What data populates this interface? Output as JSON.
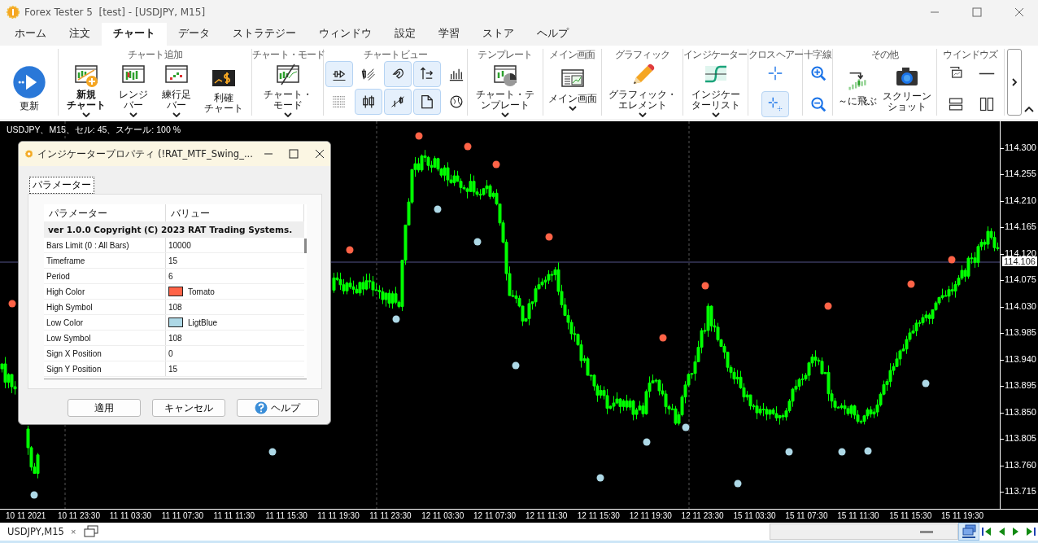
{
  "window": {
    "title": "Forex Tester 5  [test] - [USDJPY, M15]"
  },
  "menu_tabs": [
    {
      "label": "ホーム",
      "selected": false
    },
    {
      "label": "注文",
      "selected": false
    },
    {
      "label": "チャート",
      "selected": true
    },
    {
      "label": "データ",
      "selected": false
    },
    {
      "label": "ストラテジー",
      "selected": false
    },
    {
      "label": "ウィンドウ",
      "selected": false
    },
    {
      "label": "設定",
      "selected": false
    },
    {
      "label": "学習",
      "selected": false
    },
    {
      "label": "ストア",
      "selected": false
    },
    {
      "label": "ヘルプ",
      "selected": false
    }
  ],
  "ribbon": {
    "groups": [
      {
        "items": [
          {
            "kind": "large",
            "lines": [
              "更新"
            ],
            "caret": false
          }
        ]
      },
      {
        "label": "チャート追加",
        "items": [
          {
            "kind": "large",
            "lines": [
              "新規",
              "チャート"
            ],
            "caret": true,
            "default": true
          },
          {
            "kind": "large",
            "lines": [
              "レンジ",
              "バー"
            ],
            "caret": true
          },
          {
            "kind": "large",
            "lines": [
              "練行足",
              "バー"
            ],
            "caret": true
          },
          {
            "kind": "large",
            "lines": [
              "利確",
              "チャート"
            ],
            "caret": false
          }
        ]
      },
      {
        "label": "チャート・モード",
        "items": [
          {
            "kind": "large",
            "lines": [
              "チャート・",
              "モード"
            ],
            "caret": true
          }
        ]
      },
      {
        "label": "チャートビュー",
        "items": [
          {
            "kind": "small",
            "selected": true
          },
          {
            "kind": "small",
            "selected": false
          },
          {
            "kind": "small",
            "selected": true
          },
          {
            "kind": "small",
            "selected": true
          },
          {
            "kind": "small",
            "selected": false
          },
          {
            "kind": "small",
            "selected": false
          },
          {
            "kind": "small",
            "selected": true
          },
          {
            "kind": "small",
            "selected": true
          },
          {
            "kind": "small",
            "selected": true
          },
          {
            "kind": "small",
            "selected": false
          }
        ]
      },
      {
        "label": "テンプレート",
        "items": [
          {
            "kind": "large",
            "lines": [
              "チャート・テ",
              "ンプレート"
            ],
            "caret": true
          }
        ]
      },
      {
        "label": "メイン画面",
        "items": [
          {
            "kind": "large",
            "lines": [
              "メイン画面"
            ],
            "caret": true
          }
        ]
      },
      {
        "label": "グラフィック",
        "items": [
          {
            "kind": "large",
            "lines": [
              "グラフィック・",
              "エレメント"
            ],
            "caret": true
          }
        ]
      },
      {
        "label": "インジケーター",
        "items": [
          {
            "kind": "large",
            "lines": [
              "インジケー",
              "ターリスト"
            ],
            "caret": true
          }
        ]
      },
      {
        "label": "クロスヘアー",
        "items": [
          {
            "kind": "small",
            "selected": false
          },
          {
            "kind": "small",
            "selected": true
          }
        ]
      },
      {
        "label": "十字線",
        "items": [
          {
            "kind": "small",
            "selected": false
          },
          {
            "kind": "small",
            "selected": false
          }
        ]
      },
      {
        "label": "その他",
        "items": [
          {
            "kind": "large",
            "lines": [
              "～に飛ぶ"
            ],
            "caret": false
          },
          {
            "kind": "large",
            "lines": [
              "スクリーン",
              "ショット"
            ],
            "caret": false
          }
        ]
      },
      {
        "label": "ウインドウズ",
        "items": [
          {
            "kind": "small",
            "selected": false
          },
          {
            "kind": "small",
            "selected": false
          },
          {
            "kind": "small",
            "selected": false
          },
          {
            "kind": "small",
            "selected": false
          }
        ]
      }
    ]
  },
  "chart": {
    "info": "USDJPY、M15、セル: 45、スケール: 100 %",
    "price_labels": [
      "114.300",
      "114.255",
      "114.210",
      "114.165",
      "114.120",
      "114.075",
      "114.030",
      "113.985",
      "113.940",
      "113.895",
      "113.850",
      "113.805",
      "113.760",
      "113.715"
    ],
    "current_price": "114.106",
    "time_labels": [
      "10 11 2021",
      "10 11 23:30",
      "11 11 03:30",
      "11 11 07:30",
      "11 11 11:30",
      "11 11 15:30",
      "11 11 19:30",
      "11 11 23:30",
      "12 11 03:30",
      "12 11 07:30",
      "12 11 11:30",
      "12 11 15:30",
      "12 11 19:30",
      "12 11 23:30",
      "15 11 03:30",
      "15 11 07:30",
      "15 11 11:30",
      "15 11 15:30",
      "15 11 19:30"
    ]
  },
  "dialog": {
    "title": "インジケータープロパティ (!RAT_MTF_Swing_...",
    "tabs": [
      {
        "label": "パラメーター",
        "selected": true
      }
    ],
    "columns": [
      "パラメーター",
      "バリュー"
    ],
    "group_row": "ver 1.0.0 Copyright (C) 2023 RAT Trading Systems.",
    "rows": [
      {
        "kind": "text",
        "name": "Bars Limit (0 : All Bars)",
        "value": "10000"
      },
      {
        "kind": "text",
        "name": "Timeframe",
        "value": "15"
      },
      {
        "kind": "text",
        "name": "Period",
        "value": "6"
      },
      {
        "kind": "color",
        "name": "High Color",
        "value": "Tomato",
        "color": "#ff6347"
      },
      {
        "kind": "text",
        "name": "High Symbol",
        "value": "108"
      },
      {
        "kind": "color",
        "name": "Low Color",
        "value": "LigtBlue",
        "color": "#add8e6"
      },
      {
        "kind": "text",
        "name": "Low Symbol",
        "value": "108"
      },
      {
        "kind": "text",
        "name": "Sign X Position",
        "value": "0"
      },
      {
        "kind": "text",
        "name": "Sign Y Position",
        "value": "15"
      }
    ],
    "buttons": [
      {
        "kind": "plain",
        "label": "適用"
      },
      {
        "kind": "plain",
        "label": "キャンセル"
      },
      {
        "kind": "help",
        "label": "ヘルプ"
      }
    ]
  },
  "bottom_bar": {
    "tab": "USDJPY,M15",
    "close": "×"
  }
}
